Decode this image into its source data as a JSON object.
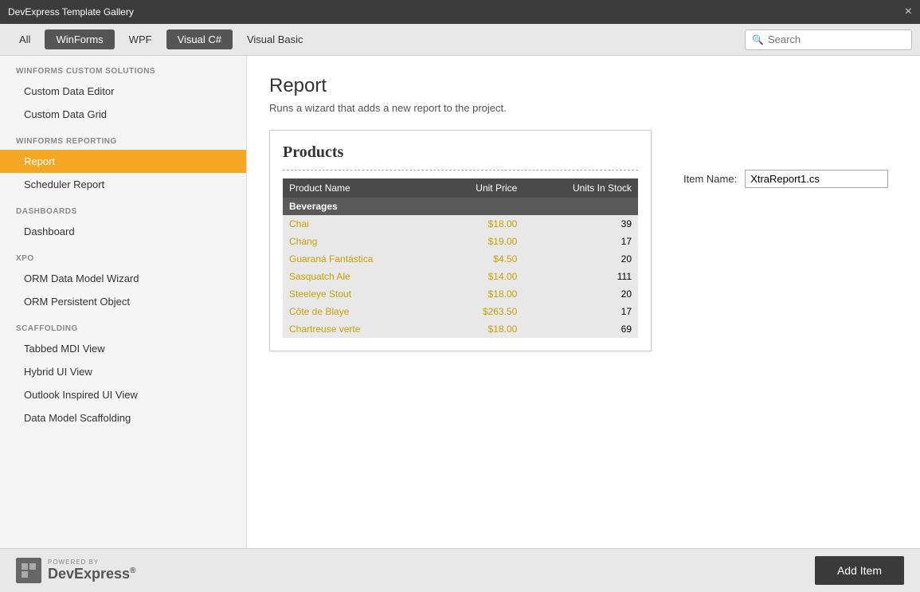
{
  "titleBar": {
    "title": "DevExpress Template Gallery",
    "closeLabel": "×"
  },
  "tabs": {
    "all": "All",
    "winforms": "WinForms",
    "wpf": "WPF",
    "visualCSharp": "Visual C#",
    "visualBasic": "Visual Basic",
    "search": {
      "placeholder": "Search",
      "value": ""
    }
  },
  "sidebar": {
    "sections": [
      {
        "label": "WinForms Custom Solutions",
        "items": [
          {
            "id": "custom-data-editor",
            "label": "Custom Data Editor",
            "active": false
          },
          {
            "id": "custom-data-grid",
            "label": "Custom Data Grid",
            "active": false
          }
        ]
      },
      {
        "label": "WinForms Reporting",
        "items": [
          {
            "id": "report",
            "label": "Report",
            "active": true
          },
          {
            "id": "scheduler-report",
            "label": "Scheduler Report",
            "active": false
          }
        ]
      },
      {
        "label": "Dashboards",
        "items": [
          {
            "id": "dashboard",
            "label": "Dashboard",
            "active": false
          }
        ]
      },
      {
        "label": "XPO",
        "items": [
          {
            "id": "orm-data-model-wizard",
            "label": "ORM Data Model Wizard",
            "active": false
          },
          {
            "id": "orm-persistent-object",
            "label": "ORM Persistent Object",
            "active": false
          }
        ]
      },
      {
        "label": "Scaffolding",
        "items": [
          {
            "id": "tabbed-mdi-view",
            "label": "Tabbed MDI View",
            "active": false
          },
          {
            "id": "hybrid-ui-view",
            "label": "Hybrid UI View",
            "active": false
          },
          {
            "id": "outlook-inspired-ui-view",
            "label": "Outlook Inspired UI View",
            "active": false
          },
          {
            "id": "data-model-scaffolding",
            "label": "Data Model Scaffolding",
            "active": false
          }
        ]
      }
    ]
  },
  "content": {
    "title": "Report",
    "description": "Runs a wizard that adds a new report to the project.",
    "itemNameLabel": "Item Name:",
    "itemNameValue": "XtraReport1.cs"
  },
  "reportPreview": {
    "title": "Products",
    "columns": [
      "Product Name",
      "Unit Price",
      "Units In Stock"
    ],
    "groups": [
      {
        "name": "Beverages",
        "rows": [
          {
            "name": "Chai",
            "price": "$18.00",
            "stock": "39",
            "alt": false
          },
          {
            "name": "Chang",
            "price": "$19.00",
            "stock": "17",
            "alt": true
          },
          {
            "name": "Guaraná Fantástica",
            "price": "$4.50",
            "stock": "20",
            "alt": false
          },
          {
            "name": "Sasquatch Ale",
            "price": "$14.00",
            "stock": "111",
            "alt": true
          },
          {
            "name": "Steeleye Stout",
            "price": "$18.00",
            "stock": "20",
            "alt": false
          },
          {
            "name": "Côte de Blaye",
            "price": "$263.50",
            "stock": "17",
            "alt": true
          },
          {
            "name": "Chartreuse verte",
            "price": "$18.00",
            "stock": "69",
            "alt": false
          }
        ]
      }
    ]
  },
  "footer": {
    "poweredBy": "POWERED BY",
    "logoText": "DevExpress",
    "logoRegistered": "®",
    "addItemLabel": "Add Item"
  }
}
